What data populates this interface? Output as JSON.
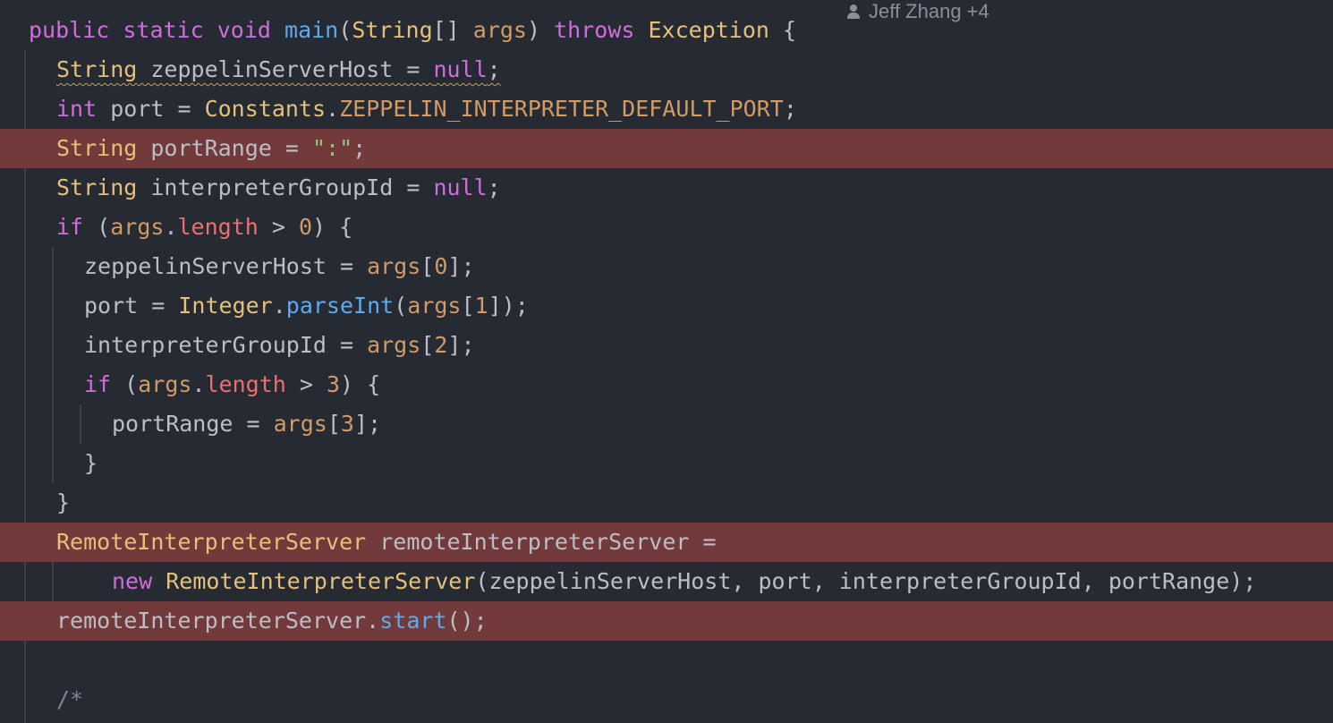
{
  "editor": {
    "blame": "Jeff Zhang +4",
    "colors": {
      "background": "#262a33",
      "highlight_line": "#723a3b",
      "keyword": "#cf6edb",
      "type": "#e5c07b",
      "method": "#5fa9ee",
      "field": "#ee6f6f",
      "string": "#98c379",
      "number": "#d19a66"
    },
    "lines": [
      {
        "highlighted": false,
        "tokens": [
          {
            "t": "public",
            "c": "kw"
          },
          {
            "t": " ",
            "c": "p"
          },
          {
            "t": "static",
            "c": "kw"
          },
          {
            "t": " ",
            "c": "p"
          },
          {
            "t": "void",
            "c": "kw"
          },
          {
            "t": " ",
            "c": "p"
          },
          {
            "t": "main",
            "c": "fn"
          },
          {
            "t": "(",
            "c": "p"
          },
          {
            "t": "String",
            "c": "ty"
          },
          {
            "t": "[] ",
            "c": "p"
          },
          {
            "t": "args",
            "c": "par"
          },
          {
            "t": ") ",
            "c": "p"
          },
          {
            "t": "throws",
            "c": "kw"
          },
          {
            "t": " ",
            "c": "p"
          },
          {
            "t": "Exception",
            "c": "ty"
          },
          {
            "t": " {",
            "c": "p"
          }
        ]
      },
      {
        "highlighted": false,
        "tokens": [
          {
            "t": "String zeppelinServerHost = null;",
            "c": "warn-line"
          }
        ]
      },
      {
        "highlighted": false,
        "tokens": [
          {
            "t": "int",
            "c": "kw"
          },
          {
            "t": " port = ",
            "c": "p"
          },
          {
            "t": "Constants",
            "c": "ty"
          },
          {
            "t": ".",
            "c": "p"
          },
          {
            "t": "ZEPPELIN_INTERPRETER_DEFAULT_PORT",
            "c": "num"
          },
          {
            "t": ";",
            "c": "p"
          }
        ]
      },
      {
        "highlighted": true,
        "tokens": [
          {
            "t": "String",
            "c": "ty"
          },
          {
            "t": " portRange = ",
            "c": "p"
          },
          {
            "t": "\":\"",
            "c": "str"
          },
          {
            "t": ";",
            "c": "p"
          }
        ]
      },
      {
        "highlighted": false,
        "tokens": [
          {
            "t": "String",
            "c": "ty"
          },
          {
            "t": " interpreterGroupId = ",
            "c": "p"
          },
          {
            "t": "null",
            "c": "kw"
          },
          {
            "t": ";",
            "c": "p"
          }
        ]
      },
      {
        "highlighted": false,
        "tokens": [
          {
            "t": "if",
            "c": "kw"
          },
          {
            "t": " (",
            "c": "p"
          },
          {
            "t": "args",
            "c": "par"
          },
          {
            "t": ".",
            "c": "p"
          },
          {
            "t": "length",
            "c": "fld"
          },
          {
            "t": " > ",
            "c": "p"
          },
          {
            "t": "0",
            "c": "num"
          },
          {
            "t": ") {",
            "c": "p"
          }
        ]
      },
      {
        "highlighted": false,
        "tokens": [
          {
            "t": "zeppelinServerHost = ",
            "c": "p"
          },
          {
            "t": "args",
            "c": "par"
          },
          {
            "t": "[",
            "c": "p"
          },
          {
            "t": "0",
            "c": "num"
          },
          {
            "t": "];",
            "c": "p"
          }
        ]
      },
      {
        "highlighted": false,
        "tokens": [
          {
            "t": "port = ",
            "c": "p"
          },
          {
            "t": "Integer",
            "c": "ty"
          },
          {
            "t": ".",
            "c": "p"
          },
          {
            "t": "parseInt",
            "c": "fn"
          },
          {
            "t": "(",
            "c": "p"
          },
          {
            "t": "args",
            "c": "par"
          },
          {
            "t": "[",
            "c": "p"
          },
          {
            "t": "1",
            "c": "num"
          },
          {
            "t": "]);",
            "c": "p"
          }
        ]
      },
      {
        "highlighted": false,
        "tokens": [
          {
            "t": "interpreterGroupId = ",
            "c": "p"
          },
          {
            "t": "args",
            "c": "par"
          },
          {
            "t": "[",
            "c": "p"
          },
          {
            "t": "2",
            "c": "num"
          },
          {
            "t": "];",
            "c": "p"
          }
        ]
      },
      {
        "highlighted": false,
        "tokens": [
          {
            "t": "if",
            "c": "kw"
          },
          {
            "t": " (",
            "c": "p"
          },
          {
            "t": "args",
            "c": "par"
          },
          {
            "t": ".",
            "c": "p"
          },
          {
            "t": "length",
            "c": "fld"
          },
          {
            "t": " > ",
            "c": "p"
          },
          {
            "t": "3",
            "c": "num"
          },
          {
            "t": ") {",
            "c": "p"
          }
        ]
      },
      {
        "highlighted": false,
        "tokens": [
          {
            "t": "portRange = ",
            "c": "p"
          },
          {
            "t": "args",
            "c": "par"
          },
          {
            "t": "[",
            "c": "p"
          },
          {
            "t": "3",
            "c": "num"
          },
          {
            "t": "];",
            "c": "p"
          }
        ]
      },
      {
        "highlighted": false,
        "tokens": [
          {
            "t": "}",
            "c": "p"
          }
        ]
      },
      {
        "highlighted": false,
        "tokens": [
          {
            "t": "}",
            "c": "p"
          }
        ]
      },
      {
        "highlighted": true,
        "tokens": [
          {
            "t": "RemoteInterpreterServer",
            "c": "ty"
          },
          {
            "t": " remoteInterpreterServer =",
            "c": "p"
          }
        ]
      },
      {
        "highlighted": false,
        "tokens": [
          {
            "t": "new",
            "c": "kw"
          },
          {
            "t": " ",
            "c": "p"
          },
          {
            "t": "RemoteInterpreterServer",
            "c": "ty"
          },
          {
            "t": "(zeppelinServerHost, port, interpreterGroupId, portRange);",
            "c": "p"
          }
        ]
      },
      {
        "highlighted": true,
        "tokens": [
          {
            "t": "remoteInterpreterServer.",
            "c": "p"
          },
          {
            "t": "start",
            "c": "fn"
          },
          {
            "t": "();",
            "c": "p"
          }
        ]
      },
      {
        "highlighted": false,
        "tokens": []
      },
      {
        "highlighted": false,
        "tokens": [
          {
            "t": "/*",
            "c": "cmt"
          }
        ]
      }
    ]
  }
}
